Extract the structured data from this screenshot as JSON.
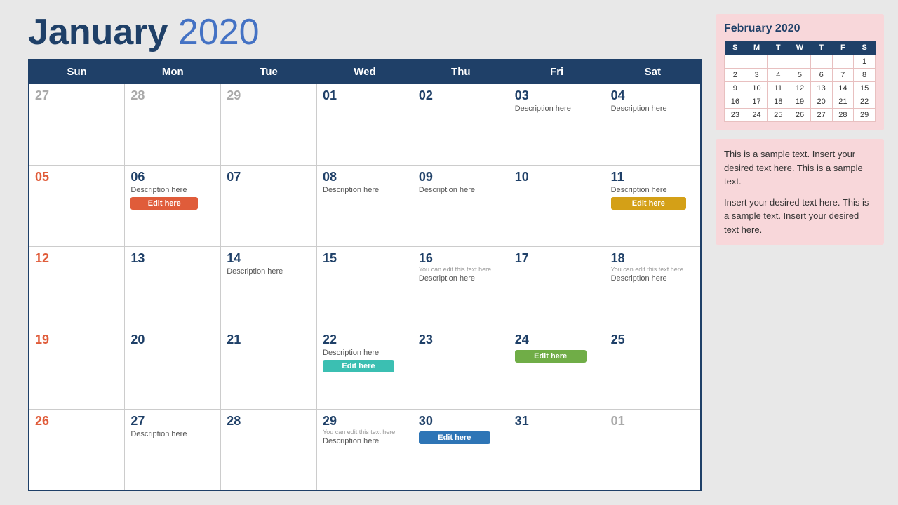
{
  "main_title_bold": "January",
  "main_title_year": " 2020",
  "headers": [
    "Sun",
    "Mon",
    "Tue",
    "Wed",
    "Thu",
    "Fri",
    "Sat"
  ],
  "weeks": [
    [
      {
        "day": "27",
        "type": "inactive",
        "desc": "",
        "btn": null,
        "note": ""
      },
      {
        "day": "28",
        "type": "inactive",
        "desc": "",
        "btn": null,
        "note": ""
      },
      {
        "day": "29",
        "type": "inactive",
        "desc": "",
        "btn": null,
        "note": ""
      },
      {
        "day": "01",
        "type": "normal",
        "desc": "",
        "btn": null,
        "note": ""
      },
      {
        "day": "02",
        "type": "normal",
        "desc": "",
        "btn": null,
        "note": ""
      },
      {
        "day": "03",
        "type": "normal",
        "desc": "Description here",
        "btn": null,
        "note": ""
      },
      {
        "day": "04",
        "type": "normal",
        "desc": "Description here",
        "btn": null,
        "note": ""
      }
    ],
    [
      {
        "day": "05",
        "type": "sunday",
        "desc": "",
        "btn": null,
        "note": ""
      },
      {
        "day": "06",
        "type": "normal",
        "desc": "Description here",
        "btn": {
          "label": "Edit here",
          "color": "orange"
        },
        "note": ""
      },
      {
        "day": "07",
        "type": "normal",
        "desc": "",
        "btn": null,
        "note": ""
      },
      {
        "day": "08",
        "type": "normal",
        "desc": "Description here",
        "btn": null,
        "note": ""
      },
      {
        "day": "09",
        "type": "normal",
        "desc": "Description here",
        "btn": null,
        "note": ""
      },
      {
        "day": "10",
        "type": "normal",
        "desc": "",
        "btn": null,
        "note": ""
      },
      {
        "day": "11",
        "type": "normal",
        "desc": "Description here",
        "btn": {
          "label": "Edit here",
          "color": "yellow"
        },
        "note": ""
      }
    ],
    [
      {
        "day": "12",
        "type": "sunday",
        "desc": "",
        "btn": null,
        "note": ""
      },
      {
        "day": "13",
        "type": "normal",
        "desc": "",
        "btn": null,
        "note": ""
      },
      {
        "day": "14",
        "type": "normal",
        "desc": "Description here",
        "btn": null,
        "note": ""
      },
      {
        "day": "15",
        "type": "normal",
        "desc": "",
        "btn": null,
        "note": ""
      },
      {
        "day": "16",
        "type": "normal",
        "desc": "Description here",
        "btn": null,
        "note": "You can edit this text here."
      },
      {
        "day": "17",
        "type": "normal",
        "desc": "",
        "btn": null,
        "note": ""
      },
      {
        "day": "18",
        "type": "normal",
        "desc": "Description here",
        "btn": null,
        "note": "You can edit this text here."
      }
    ],
    [
      {
        "day": "19",
        "type": "sunday",
        "desc": "",
        "btn": null,
        "note": ""
      },
      {
        "day": "20",
        "type": "normal",
        "desc": "",
        "btn": null,
        "note": ""
      },
      {
        "day": "21",
        "type": "normal",
        "desc": "",
        "btn": null,
        "note": ""
      },
      {
        "day": "22",
        "type": "normal",
        "desc": "Description here",
        "btn": {
          "label": "Edit here",
          "color": "teal"
        },
        "note": ""
      },
      {
        "day": "23",
        "type": "normal",
        "desc": "",
        "btn": null,
        "note": ""
      },
      {
        "day": "24",
        "type": "normal",
        "desc": "",
        "btn": {
          "label": "Edit here",
          "color": "green"
        },
        "note": ""
      },
      {
        "day": "25",
        "type": "normal",
        "desc": "",
        "btn": null,
        "note": ""
      }
    ],
    [
      {
        "day": "26",
        "type": "sunday",
        "desc": "",
        "btn": null,
        "note": ""
      },
      {
        "day": "27",
        "type": "normal",
        "desc": "Description here",
        "btn": null,
        "note": ""
      },
      {
        "day": "28",
        "type": "normal",
        "desc": "",
        "btn": null,
        "note": ""
      },
      {
        "day": "29",
        "type": "normal",
        "desc": "Description here",
        "btn": null,
        "note": "You can edit this text here."
      },
      {
        "day": "30",
        "type": "normal",
        "desc": "",
        "btn": {
          "label": "Edit here",
          "color": "blue"
        },
        "note": ""
      },
      {
        "day": "31",
        "type": "normal",
        "desc": "",
        "btn": null,
        "note": ""
      },
      {
        "day": "01",
        "type": "inactive",
        "desc": "",
        "btn": null,
        "note": ""
      }
    ]
  ],
  "sidebar": {
    "mini_cal_title": "February 2020",
    "mini_headers": [
      "S",
      "M",
      "T",
      "W",
      "T",
      "F",
      "S"
    ],
    "mini_weeks": [
      [
        "",
        "",
        "",
        "",
        "",
        "",
        "1"
      ],
      [
        "2",
        "3",
        "4",
        "5",
        "6",
        "7",
        "8"
      ],
      [
        "9",
        "10",
        "11",
        "12",
        "13",
        "14",
        "15"
      ],
      [
        "16",
        "17",
        "18",
        "19",
        "20",
        "21",
        "22"
      ],
      [
        "23",
        "24",
        "25",
        "26",
        "27",
        "28",
        "29"
      ]
    ],
    "text1": "This is a sample text. Insert your desired text here. This is a sample text.",
    "text2": "Insert your desired text here. This is a sample text. Insert your desired text here."
  }
}
